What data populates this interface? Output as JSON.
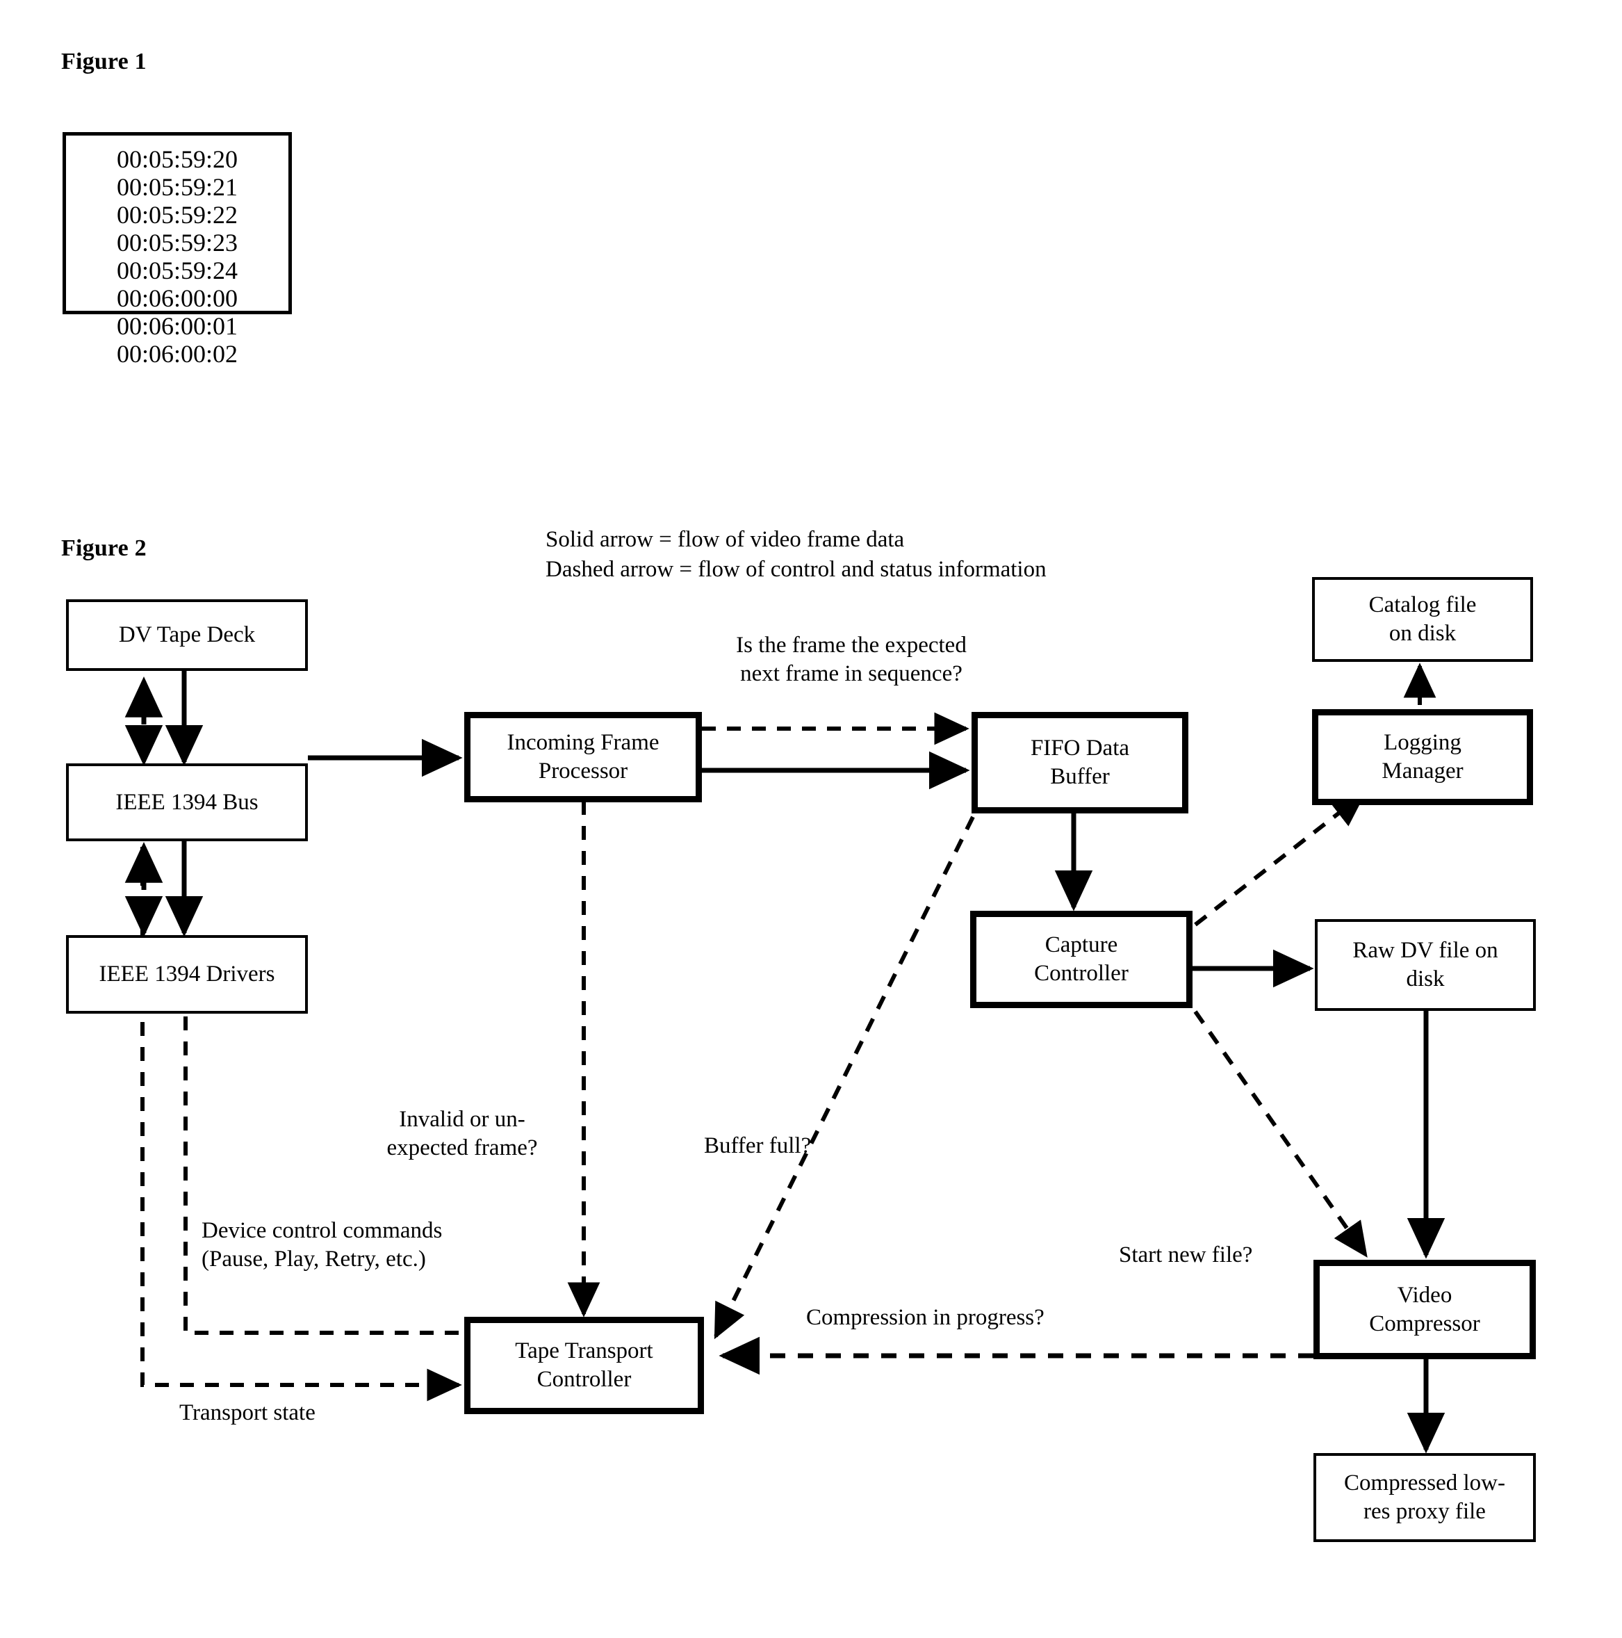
{
  "figure1": {
    "title": "Figure 1",
    "timecodes": [
      "00:05:59:20",
      "00:05:59:21",
      "00:05:59:22",
      "00:05:59:23",
      "00:05:59:24",
      "00:06:00:00",
      "00:06:00:01",
      "00:06:00:02"
    ]
  },
  "figure2": {
    "title": "Figure 2",
    "legend": {
      "solid": "Solid arrow = flow of video frame data",
      "dashed": "Dashed arrow = flow of control and status information"
    },
    "nodes": {
      "dv_tape_deck": "DV Tape Deck",
      "ieee_bus": "IEEE 1394 Bus",
      "ieee_drivers": "IEEE 1394 Drivers",
      "incoming_frame_processor": "Incoming Frame\nProcessor",
      "fifo_data_buffer": "FIFO Data\nBuffer",
      "logging_manager": "Logging\nManager",
      "catalog_file": "Catalog file\non disk",
      "capture_controller": "Capture\nController",
      "raw_dv_file": "Raw DV file on\ndisk",
      "tape_transport_controller": "Tape Transport\nController",
      "video_compressor": "Video\nCompressor",
      "compressed_proxy_file": "Compressed low-\nres proxy file"
    },
    "edge_labels": {
      "expected_next_frame": "Is the frame the expected\nnext frame in sequence?",
      "invalid_frame": "Invalid or un-\nexpected  frame?",
      "buffer_full": "Buffer full?",
      "device_control": "Device control commands\n(Pause, Play, Retry, etc.)",
      "transport_state": "Transport state",
      "compression_in_progress": "Compression in progress?",
      "start_new_file": "Start new file?"
    }
  },
  "colors": {
    "ink": "#000000",
    "paper": "#ffffff"
  }
}
